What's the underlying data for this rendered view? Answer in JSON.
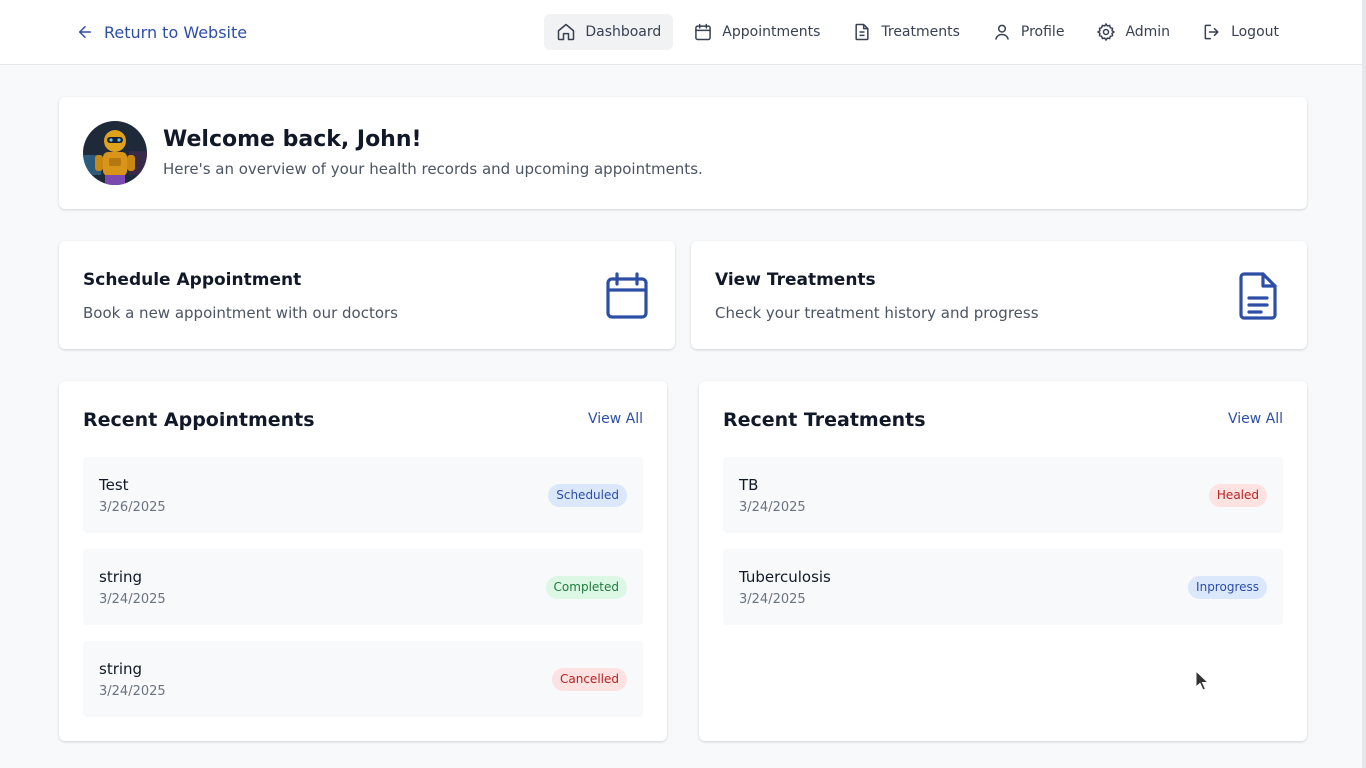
{
  "header": {
    "return_label": "Return to Website",
    "nav": [
      {
        "label": "Dashboard",
        "icon": "home-icon",
        "active": true
      },
      {
        "label": "Appointments",
        "icon": "calendar-icon"
      },
      {
        "label": "Treatments",
        "icon": "document-icon"
      },
      {
        "label": "Profile",
        "icon": "user-icon"
      },
      {
        "label": "Admin",
        "icon": "gear-icon"
      },
      {
        "label": "Logout",
        "icon": "logout-icon"
      }
    ]
  },
  "welcome": {
    "title": "Welcome back, John!",
    "subtitle": "Here's an overview of your health records and upcoming appointments."
  },
  "actions": {
    "schedule": {
      "title": "Schedule Appointment",
      "subtitle": "Book a new appointment with our doctors",
      "icon": "calendar-icon"
    },
    "treatments": {
      "title": "View Treatments",
      "subtitle": "Check your treatment history and progress",
      "icon": "document-icon"
    }
  },
  "recent_appointments": {
    "title": "Recent Appointments",
    "view_all": "View All",
    "items": [
      {
        "name": "Test",
        "date": "3/26/2025",
        "status": "Scheduled"
      },
      {
        "name": "string",
        "date": "3/24/2025",
        "status": "Completed"
      },
      {
        "name": "string",
        "date": "3/24/2025",
        "status": "Cancelled"
      }
    ]
  },
  "recent_treatments": {
    "title": "Recent Treatments",
    "view_all": "View All",
    "items": [
      {
        "name": "TB",
        "date": "3/24/2025",
        "status": "Healed"
      },
      {
        "name": "Tuberculosis",
        "date": "3/24/2025",
        "status": "Inprogress"
      }
    ]
  },
  "colors": {
    "accent": "#2d4ea6",
    "status_blue_bg": "#dbe7fb",
    "status_green_bg": "#dcf7e4",
    "status_red_bg": "#fde2e2"
  }
}
